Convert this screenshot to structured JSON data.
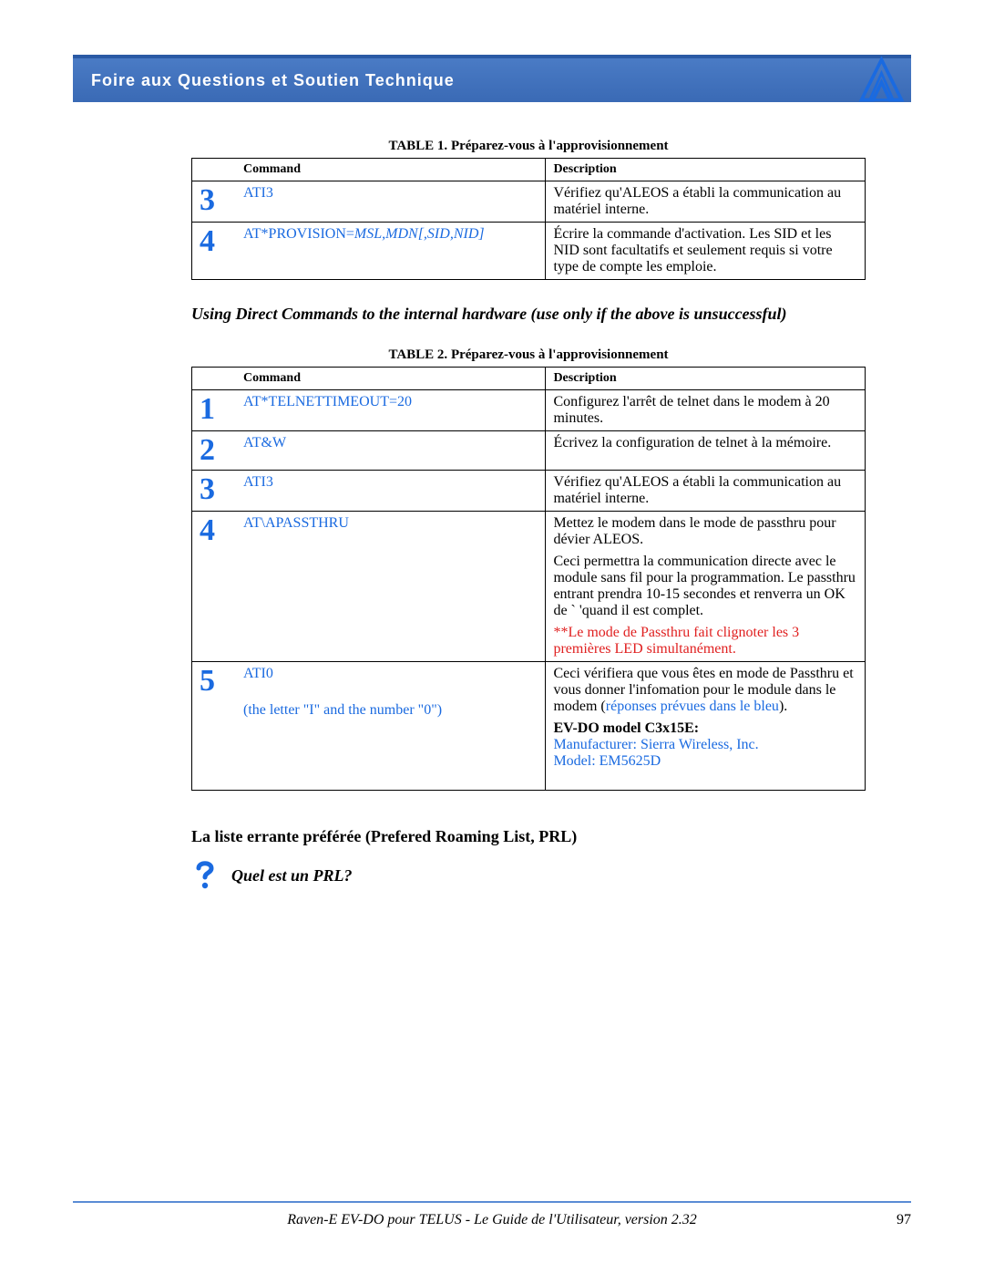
{
  "header": {
    "title": "Foire aux Questions et Soutien Technique"
  },
  "table1": {
    "caption_label": "TABLE 1.",
    "caption_text": "Préparez-vous à l'approvisionnement",
    "col_command": "Command",
    "col_description": "Description",
    "rows": [
      {
        "n": "3",
        "cmd": "ATI3",
        "cmd_param": "",
        "desc": "Vérifiez qu'ALEOS a établi la communication au matériel interne."
      },
      {
        "n": "4",
        "cmd": "AT*PROVISION=",
        "cmd_param": "MSL,MDN[,SID,NID]",
        "desc": "Écrire la commande d'activation. Les SID et les NID sont facultatifs et seulement requis si votre type de compte les emploie."
      }
    ]
  },
  "mid_note": "Using Direct Commands to the internal hardware (use only if the above is unsuccessful)",
  "table2": {
    "caption_label": "TABLE 2.",
    "caption_text": "Préparez-vous à l'approvisionnement",
    "col_command": "Command",
    "col_description": "Description",
    "rows": [
      {
        "n": "1",
        "cmd": "AT*TELNETTIMEOUT=20",
        "cmd_sub": "",
        "desc": "Configurez l'arrêt de telnet dans le modem à 20 minutes."
      },
      {
        "n": "2",
        "cmd": "AT&W",
        "cmd_sub": "",
        "desc": "Écrivez la configuration de telnet à la mémoire."
      },
      {
        "n": "3",
        "cmd": "ATI3",
        "cmd_sub": "",
        "desc": "Vérifiez qu'ALEOS a établi la communication au matériel interne."
      },
      {
        "n": "4",
        "cmd": "AT\\APASSTHRU",
        "cmd_sub": "",
        "desc": "Mettez le modem dans le mode de passthru pour dévier ALEOS.",
        "desc2": "Ceci permettra la communication directe avec le module sans fil pour la programmation. Le passthru entrant prendra 10-15 secondes et renverra un OK de ` 'quand il est complet.",
        "desc_red": "**Le mode de Passthru fait clignoter les 3 premières LED simultanément."
      },
      {
        "n": "5",
        "cmd": "ATI0",
        "cmd_sub": "(the letter \"I\" and the number \"0\")",
        "desc": "Ceci vérifiera que vous êtes en mode de Passthru et vous donner l'infomation pour le module dans le modem (",
        "desc_blue_inline": "réponses prévues dans le bleu",
        "desc_after": ").",
        "model_label": "EV-DO model C3x15E:",
        "model_line1": "Manufacturer: Sierra Wireless, Inc.",
        "model_line2": "Model: EM5625D"
      }
    ]
  },
  "prl_heading": "La liste errante préférée (Prefered Roaming List, PRL)",
  "prl_question": "Quel est un PRL?",
  "footer": {
    "title": "Raven-E EV-DO pour TELUS - Le Guide de l'Utilisateur, version 2.32",
    "page": "97"
  }
}
